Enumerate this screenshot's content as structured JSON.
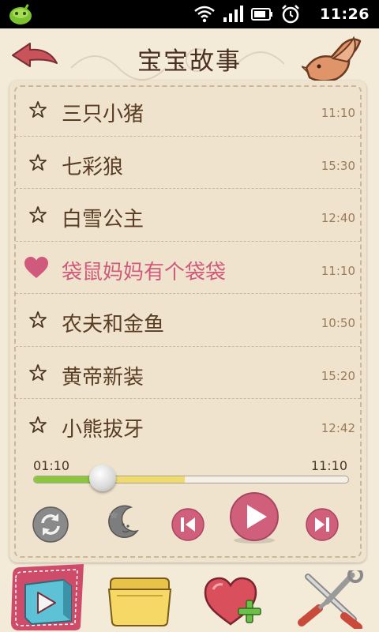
{
  "status_bar": {
    "time": "11:26"
  },
  "header": {
    "title": "宝宝故事"
  },
  "stories": [
    {
      "title": "三只小猪",
      "duration": "11:10",
      "favorite": false
    },
    {
      "title": "七彩狼",
      "duration": "15:30",
      "favorite": false
    },
    {
      "title": "白雪公主",
      "duration": "12:40",
      "favorite": false
    },
    {
      "title": "袋鼠妈妈有个袋袋",
      "duration": "11:10",
      "favorite": true
    },
    {
      "title": "农夫和金鱼",
      "duration": "10:50",
      "favorite": false
    },
    {
      "title": "黄帝新装",
      "duration": "15:20",
      "favorite": false
    },
    {
      "title": "小熊拔牙",
      "duration": "12:42",
      "favorite": false
    }
  ],
  "player": {
    "current_time": "01:10",
    "total_time": "11:10",
    "progress_fraction": 0.22,
    "buffered_fraction": 0.48
  },
  "colors": {
    "accent": "#d05a7c",
    "text": "#5a3c24",
    "progress_fill": "#8cc63f",
    "progress_buffer": "#f0dc6e"
  },
  "icons": {
    "back": "back-arrow-icon",
    "bird": "bird-icon",
    "star": "star-outline-icon",
    "heart": "heart-icon",
    "repeat": "repeat-icon",
    "sleep": "moon-icon",
    "previous": "previous-icon",
    "play": "play-icon",
    "next": "next-icon",
    "tab_player": "play-box-icon",
    "tab_library": "folder-icon",
    "tab_favorites": "heart-plus-icon",
    "tab_settings": "tools-icon"
  }
}
